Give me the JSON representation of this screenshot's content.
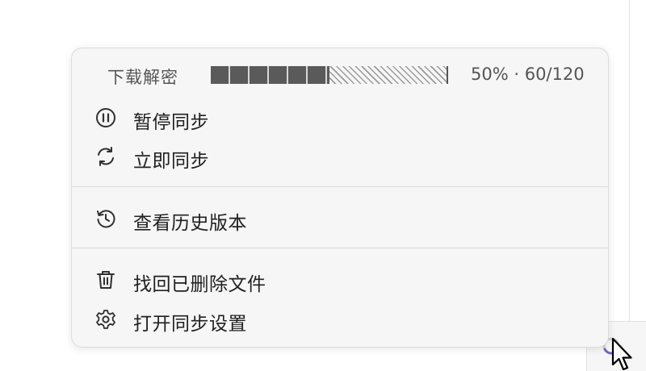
{
  "menu": {
    "progress": {
      "label": "下载解密",
      "percent": 50,
      "text": "50% · 60/120"
    },
    "items": [
      {
        "label": "暂停同步",
        "icon": "pause-circle-icon"
      },
      {
        "label": "立即同步",
        "icon": "refresh-icon"
      },
      {
        "label": "查看历史版本",
        "icon": "history-icon"
      },
      {
        "label": "找回已删除文件",
        "icon": "trash-icon"
      },
      {
        "label": "打开同步设置",
        "icon": "gear-icon"
      }
    ]
  },
  "colors": {
    "menu_bg": "#f6f6f6",
    "text": "#202020",
    "muted_text": "#555555",
    "indicator_accent": "#7b5cd6"
  }
}
